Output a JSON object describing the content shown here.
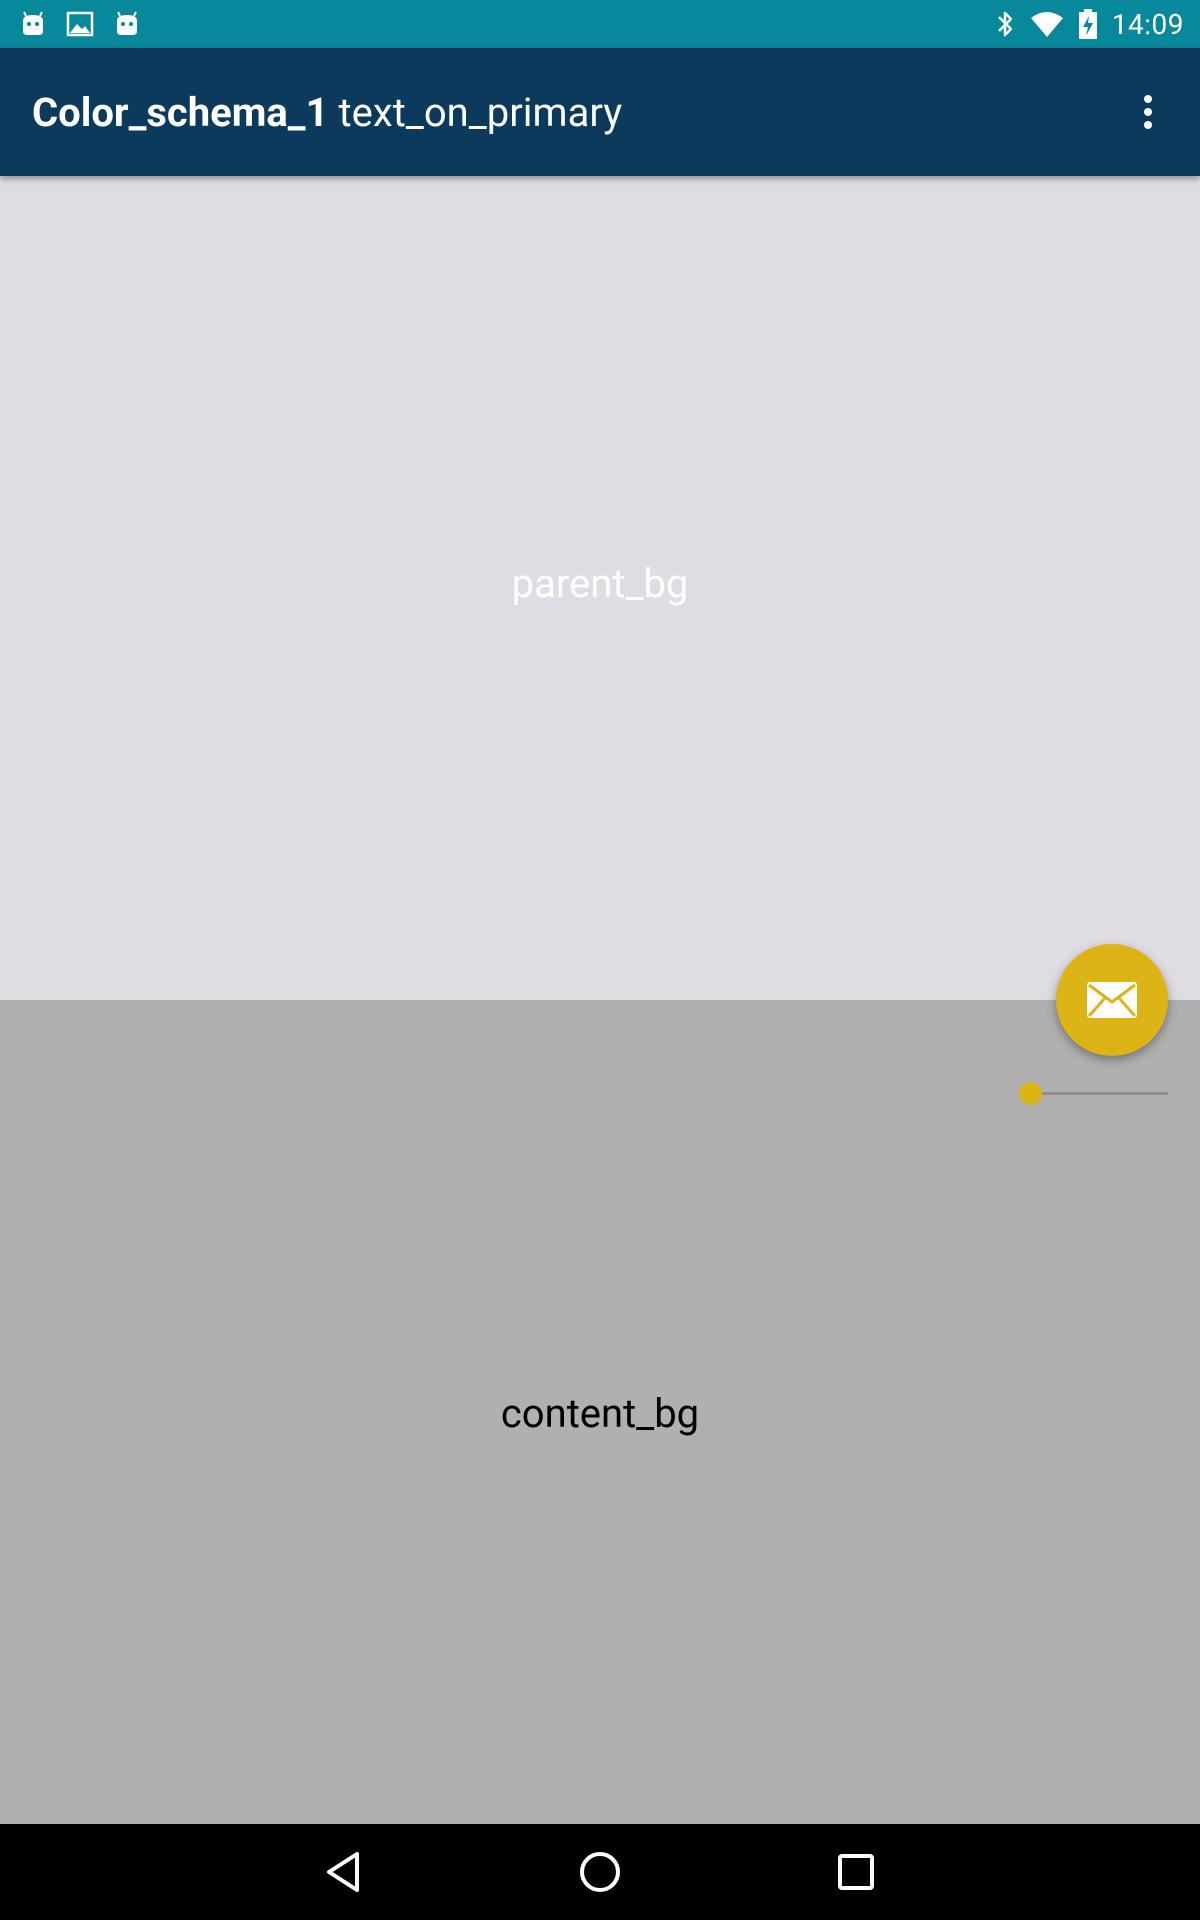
{
  "status_bar": {
    "time": "14:09",
    "left_icons": [
      "android-icon",
      "image-icon",
      "android-icon"
    ],
    "right_icons": [
      "bluetooth-icon",
      "wifi-icon",
      "battery-charging-icon"
    ],
    "color": "#07889b"
  },
  "app_bar": {
    "title_bold": "Color_schema_1",
    "title_rest": "text_on_primary",
    "overflow_icon": "more-vert-icon",
    "color": "#0b3a5c"
  },
  "parent": {
    "label": "parent_bg",
    "color": "#dfdce3"
  },
  "content": {
    "label": "content_bg",
    "color": "#b0b0b0"
  },
  "slider": {
    "value": 0,
    "accent": "#dab513"
  },
  "fab": {
    "icon": "mail-icon",
    "color": "#dcb415"
  },
  "nav_bar": {
    "buttons": [
      "back-icon",
      "home-icon",
      "recents-icon"
    ]
  }
}
